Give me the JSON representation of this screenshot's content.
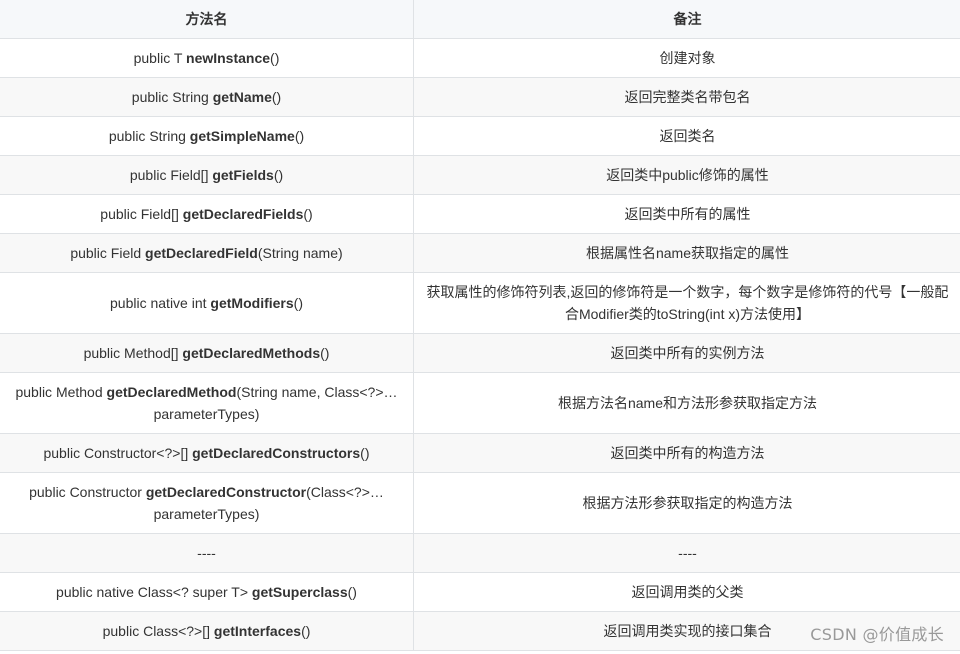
{
  "table": {
    "headers": [
      "方法名",
      "备注"
    ],
    "rows": [
      {
        "pre": "public T ",
        "name": "newInstance",
        "post": "()",
        "note": "创建对象"
      },
      {
        "pre": "public String ",
        "name": "getName",
        "post": "()",
        "note": "返回完整类名带包名"
      },
      {
        "pre": "public String ",
        "name": "getSimpleName",
        "post": "()",
        "note": "返回类名"
      },
      {
        "pre": "public Field[] ",
        "name": "getFields",
        "post": "()",
        "note": "返回类中public修饰的属性"
      },
      {
        "pre": "public Field[] ",
        "name": "getDeclaredFields",
        "post": "()",
        "note": "返回类中所有的属性"
      },
      {
        "pre": "public Field ",
        "name": "getDeclaredField",
        "post": "(String name)",
        "note": "根据属性名name获取指定的属性"
      },
      {
        "pre": "public native int ",
        "name": "getModifiers",
        "post": "()",
        "note": "获取属性的修饰符列表,返回的修饰符是一个数字，每个数字是修饰符的代号【一般配合Modifier类的toString(int x)方法使用】"
      },
      {
        "pre": "public Method[] ",
        "name": "getDeclaredMethods",
        "post": "()",
        "note": "返回类中所有的实例方法"
      },
      {
        "pre": "public Method ",
        "name": "getDeclaredMethod",
        "post": "(String name, Class<?>… parameterTypes)",
        "note": "根据方法名name和方法形参获取指定方法"
      },
      {
        "pre": "public Constructor<?>[] ",
        "name": "getDeclaredConstructors",
        "post": "()",
        "note": "返回类中所有的构造方法"
      },
      {
        "pre": "public Constructor ",
        "name": "getDeclaredConstructor",
        "post": "(Class<?>… parameterTypes)",
        "note": "根据方法形参获取指定的构造方法"
      },
      {
        "pre": "----",
        "name": "",
        "post": "",
        "note": "----"
      },
      {
        "pre": "public native Class<? super T> ",
        "name": "getSuperclass",
        "post": "()",
        "note": "返回调用类的父类"
      },
      {
        "pre": "public Class<?>[] ",
        "name": "getInterfaces",
        "post": "()",
        "note": "返回调用类实现的接口集合"
      }
    ]
  },
  "watermark": "CSDN @价值成长"
}
